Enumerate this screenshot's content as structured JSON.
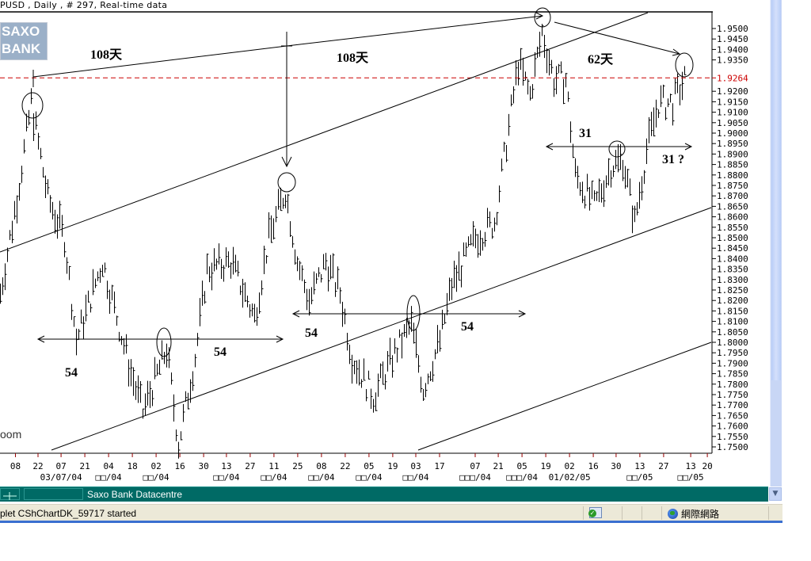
{
  "header": {
    "title": "PUSD , Daily , # 297, Real-time data"
  },
  "logo": {
    "line1": "SAXO",
    "line2": "BANK"
  },
  "watermark": "oom",
  "annotations": {
    "days_1": "108天",
    "days_2": "108天",
    "days_3": "62天",
    "count_31": "31",
    "count_31q": "31 ?",
    "count_54_a": "54",
    "count_54_b": "54",
    "count_54_c": "54",
    "count_54_d": "54"
  },
  "chart_data": {
    "type": "bar",
    "subtype": "ohlc",
    "title": "PUSD , Daily , # 297, Real-time data",
    "ylim": [
      1.7475,
      1.9575
    ],
    "y_ticks": [
      "1.9500",
      "1.9450",
      "1.9400",
      "1.9350",
      "1.9200",
      "1.9150",
      "1.9100",
      "1.9050",
      "1.9000",
      "1.8950",
      "1.8900",
      "1.8850",
      "1.8800",
      "1.8750",
      "1.8700",
      "1.8650",
      "1.8600",
      "1.8550",
      "1.8500",
      "1.8450",
      "1.8400",
      "1.8350",
      "1.8300",
      "1.8250",
      "1.8200",
      "1.8150",
      "1.8100",
      "1.8050",
      "1.8000",
      "1.7950",
      "1.7900",
      "1.7850",
      "1.7800",
      "1.7750",
      "1.7700",
      "1.7650",
      "1.7600",
      "1.7550",
      "1.7500"
    ],
    "current_price": "1.9264",
    "current_price_color": "#cc0000",
    "xlim": [
      0,
      300
    ],
    "x_ticks": [
      {
        "day": 6.5,
        "label": "08"
      },
      {
        "day": 16,
        "label": "22"
      },
      {
        "day": 25.7,
        "label": "07"
      },
      {
        "day": 35.7,
        "label": "21"
      },
      {
        "day": 45.7,
        "label": "04"
      },
      {
        "day": 55.7,
        "label": "18"
      },
      {
        "day": 65.7,
        "label": "02"
      },
      {
        "day": 75.7,
        "label": "16"
      },
      {
        "day": 85.7,
        "label": "30"
      },
      {
        "day": 95.3,
        "label": "13"
      },
      {
        "day": 105.3,
        "label": "27"
      },
      {
        "day": 115.3,
        "label": "11"
      },
      {
        "day": 125.3,
        "label": "25"
      },
      {
        "day": 135.3,
        "label": "08"
      },
      {
        "day": 145.3,
        "label": "22"
      },
      {
        "day": 155.3,
        "label": "05"
      },
      {
        "day": 165.3,
        "label": "19"
      },
      {
        "day": 175,
        "label": "03"
      },
      {
        "day": 185,
        "label": "17"
      },
      {
        "day": 200,
        "label": "07"
      },
      {
        "day": 209.7,
        "label": "21"
      },
      {
        "day": 219.7,
        "label": "05"
      },
      {
        "day": 229.7,
        "label": "19"
      },
      {
        "day": 239.7,
        "label": "02"
      },
      {
        "day": 249.7,
        "label": "16"
      },
      {
        "day": 259.3,
        "label": "30"
      },
      {
        "day": 269.3,
        "label": "13"
      },
      {
        "day": 279.3,
        "label": "27"
      },
      {
        "day": 290.7,
        "label": "13"
      },
      {
        "day": 297.7,
        "label": "20"
      }
    ],
    "month_labels": [
      {
        "day": 25.7,
        "label": "03/07/04"
      },
      {
        "day": 45.7,
        "label": "□□/04"
      },
      {
        "day": 65.7,
        "label": "□□/04"
      },
      {
        "day": 95.3,
        "label": "□□/04"
      },
      {
        "day": 115.3,
        "label": "□□/04"
      },
      {
        "day": 135.3,
        "label": "□□/04"
      },
      {
        "day": 155.3,
        "label": "□□/04"
      },
      {
        "day": 175,
        "label": "□□/04"
      },
      {
        "day": 200,
        "label": "□□□/04"
      },
      {
        "day": 219.7,
        "label": "□□□/04"
      },
      {
        "day": 239.7,
        "label": "01/02/05"
      },
      {
        "day": 269.3,
        "label": "□□/05"
      },
      {
        "day": 290.7,
        "label": "□□/05"
      }
    ],
    "price_path": [
      [
        0,
        1.8234
      ],
      [
        7,
        1.8689
      ],
      [
        13,
        1.9144
      ],
      [
        20,
        1.8689
      ],
      [
        27,
        1.85
      ],
      [
        32,
        1.8007
      ],
      [
        43,
        1.8386
      ],
      [
        55,
        1.7855
      ],
      [
        60,
        1.7666
      ],
      [
        70,
        1.7969
      ],
      [
        75,
        1.7514
      ],
      [
        82,
        1.7931
      ],
      [
        87,
        1.8348
      ],
      [
        97,
        1.8386
      ],
      [
        107,
        1.812
      ],
      [
        113,
        1.85
      ],
      [
        120,
        1.8727
      ],
      [
        125,
        1.8386
      ],
      [
        130,
        1.8196
      ],
      [
        137,
        1.8386
      ],
      [
        143,
        1.8234
      ],
      [
        148,
        1.7931
      ],
      [
        157,
        1.7742
      ],
      [
        167,
        1.7969
      ],
      [
        173,
        1.8082
      ],
      [
        178,
        1.7779
      ],
      [
        185,
        1.8007
      ],
      [
        190,
        1.8272
      ],
      [
        200,
        1.85
      ],
      [
        208,
        1.8575
      ],
      [
        213,
        1.8954
      ],
      [
        218,
        1.9333
      ],
      [
        223,
        1.9182
      ],
      [
        228,
        1.9485
      ],
      [
        233,
        1.9257
      ],
      [
        238,
        1.9257
      ],
      [
        242,
        1.8803
      ],
      [
        250,
        1.8651
      ],
      [
        257,
        1.884
      ],
      [
        262,
        1.8878
      ],
      [
        267,
        1.8575
      ],
      [
        272,
        1.8916
      ],
      [
        277,
        1.9144
      ],
      [
        283,
        1.9144
      ],
      [
        288,
        1.9257
      ]
    ]
  },
  "footer": {
    "bar_label": "Saxo Bank Datacentre",
    "status_text": "plet CShChartDK_59717 started",
    "zone_label": "網際網路"
  }
}
